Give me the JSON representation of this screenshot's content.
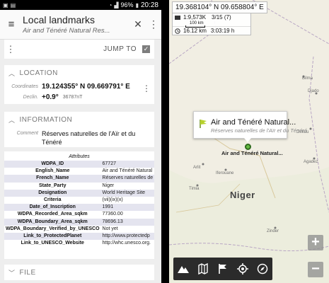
{
  "status_bar": {
    "battery": "96%",
    "time": "20:28"
  },
  "toolbar": {
    "title": "Local landmarks",
    "subtitle": "Air and Ténéré Natural Res..."
  },
  "jump": {
    "label": "JUMP TO"
  },
  "location": {
    "header": "LOCATION",
    "coordinates_label": "Coordinates",
    "coordinates_value": "19.124355° N 09.669791° E",
    "declin_label": "Declin.",
    "declin_value": "+0.9°",
    "declin_extra": "36787nT"
  },
  "information": {
    "header": "INFORMATION",
    "comment_label": "Comment",
    "comment_value": "Réserves naturelles de l'Aïr et du Ténéré"
  },
  "attributes": {
    "caption": "Attributes",
    "rows": [
      {
        "key": "WDPA_ID",
        "value": "67727"
      },
      {
        "key": "English_Name",
        "value": "Air and Ténéré Natural"
      },
      {
        "key": "French_Name",
        "value": "Réserves naturelles de"
      },
      {
        "key": "State_Party",
        "value": "Niger"
      },
      {
        "key": "Designation",
        "value": "World Heritage Site"
      },
      {
        "key": "Criteria",
        "value": "(vii)(ix)(x)"
      },
      {
        "key": "Date_of_Inscription",
        "value": "1991"
      },
      {
        "key": "WDPA_Recorded_Area_sqkm",
        "value": "77360.00"
      },
      {
        "key": "WDPA_Boundary_Area_sqkm",
        "value": "78696.13"
      },
      {
        "key": "WDPA_Boundary_Verified_by_UNESCO",
        "value": "Not yet"
      },
      {
        "key": "Link_to_ProtectedPlanet",
        "value": "http://www.protectedp"
      },
      {
        "key": "Link_to_UNESCO_Website",
        "value": "http://whc.unesco.org."
      }
    ]
  },
  "file": {
    "header": "FILE"
  },
  "map": {
    "coordinates": "19.368104° N 09.658804° E",
    "scale_ratio": "1:9,573K",
    "page": "3/15 (7)",
    "scale_bar_label": "100 km",
    "distance": "16.12 km",
    "duration": "3:03:19 h",
    "popup_title": "Air and Ténéré Natural...",
    "popup_subtitle": "Réserves naturelles de l'Aïr et du Ténéré",
    "marker_label": "Air and Ténéré Natural...",
    "country_label": "Niger",
    "places": [
      "Djado",
      "Bilma",
      "Dirkou",
      "Agadez",
      "Arlit",
      "Iferouane",
      "Timia",
      "Zinder"
    ],
    "zoom_in": "+",
    "zoom_out": "−"
  }
}
